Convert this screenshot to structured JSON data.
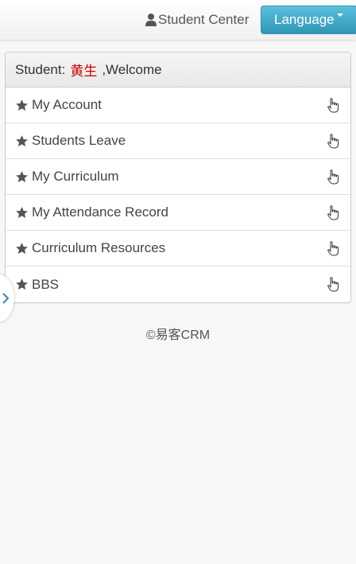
{
  "header": {
    "student_center_label": "Student Center",
    "language_button_label": "Language",
    "accent_color": "#5bc0de"
  },
  "welcome": {
    "prefix": "Student:",
    "student_name": "黄生",
    "suffix": ",Welcome",
    "name_color": "#cc0000"
  },
  "menu": {
    "items": [
      {
        "label": "My Account",
        "icon": "star-icon",
        "action_icon": "pointer-hand-icon"
      },
      {
        "label": "Students Leave",
        "icon": "star-icon",
        "action_icon": "pointer-hand-icon"
      },
      {
        "label": "My Curriculum",
        "icon": "star-icon",
        "action_icon": "pointer-hand-icon"
      },
      {
        "label": "My Attendance Record",
        "icon": "star-icon",
        "action_icon": "pointer-hand-icon"
      },
      {
        "label": "Curriculum Resources",
        "icon": "star-icon",
        "action_icon": "pointer-hand-icon"
      },
      {
        "label": "BBS",
        "icon": "star-icon",
        "action_icon": "pointer-hand-icon"
      }
    ]
  },
  "side_toggle": {
    "icon": "chevron-right-icon"
  },
  "footer": {
    "copyright": "©易客CRM"
  }
}
